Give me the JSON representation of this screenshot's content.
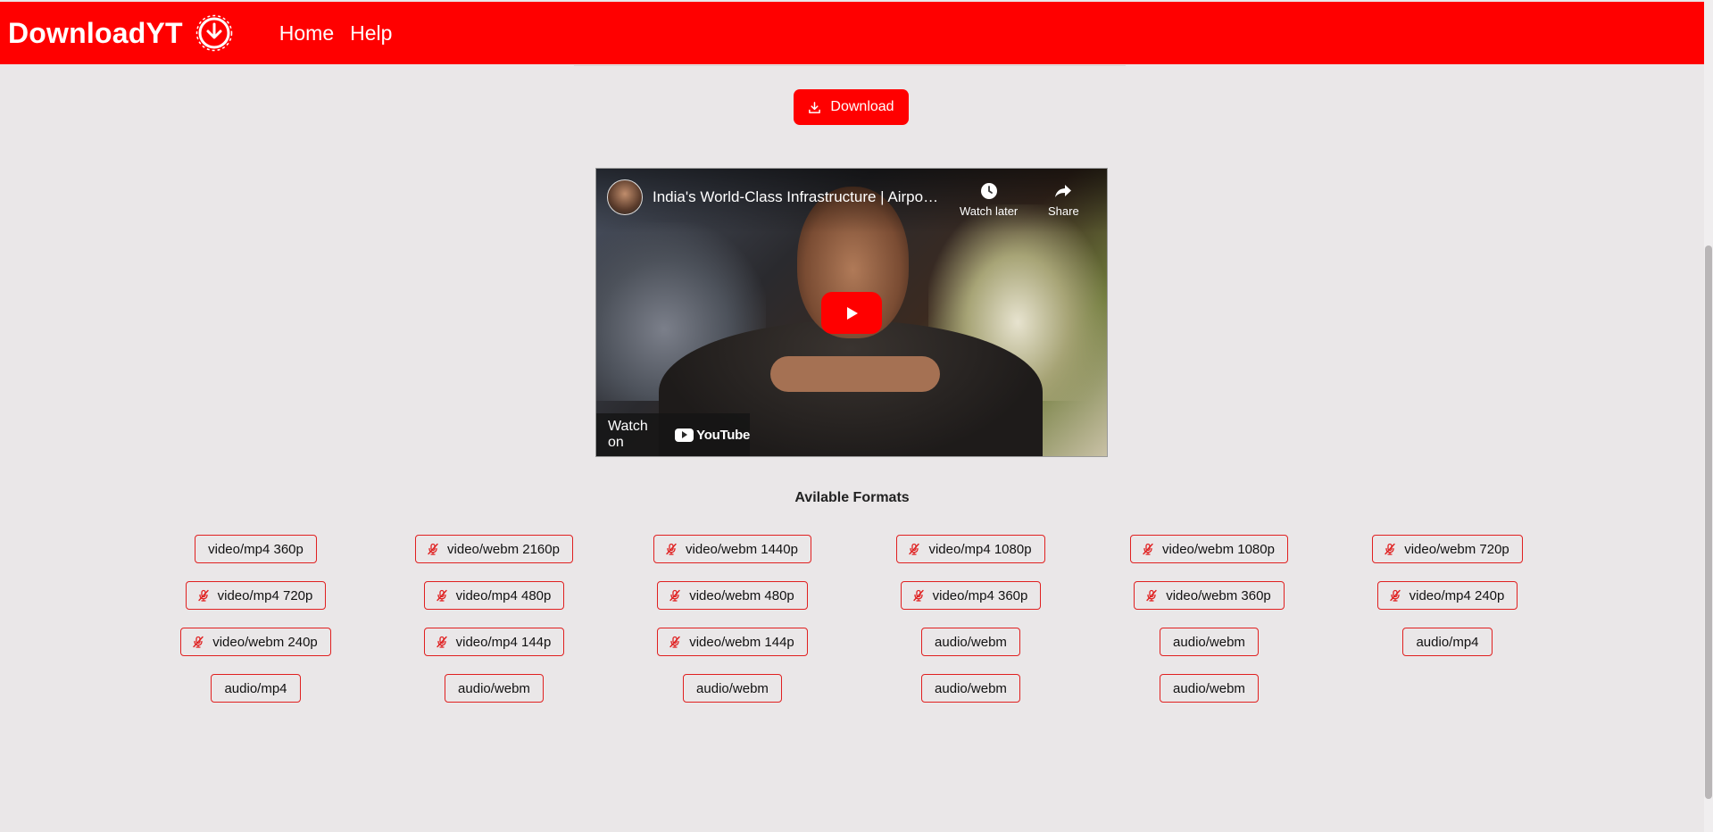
{
  "nav": {
    "brand": "DownloadYT",
    "links": [
      {
        "label": "Home"
      },
      {
        "label": "Help"
      }
    ],
    "color": "#ff0000"
  },
  "download_button": {
    "label": "Download"
  },
  "video": {
    "title": "India's World-Class Infrastructure | Airpo…",
    "watch_later": "Watch later",
    "share": "Share",
    "watch_on": "Watch on",
    "youtube": "YouTube"
  },
  "formats": {
    "heading": "Avilable Formats",
    "items": [
      {
        "label": "video/mp4 360p",
        "no_audio": false
      },
      {
        "label": "video/webm 2160p",
        "no_audio": true
      },
      {
        "label": "video/webm 1440p",
        "no_audio": true
      },
      {
        "label": "video/mp4 1080p",
        "no_audio": true
      },
      {
        "label": "video/webm 1080p",
        "no_audio": true
      },
      {
        "label": "video/webm 720p",
        "no_audio": true
      },
      {
        "label": "video/mp4 720p",
        "no_audio": true
      },
      {
        "label": "video/mp4 480p",
        "no_audio": true
      },
      {
        "label": "video/webm 480p",
        "no_audio": true
      },
      {
        "label": "video/mp4 360p",
        "no_audio": true
      },
      {
        "label": "video/webm 360p",
        "no_audio": true
      },
      {
        "label": "video/mp4 240p",
        "no_audio": true
      },
      {
        "label": "video/webm 240p",
        "no_audio": true
      },
      {
        "label": "video/mp4 144p",
        "no_audio": true
      },
      {
        "label": "video/webm 144p",
        "no_audio": true
      },
      {
        "label": "audio/webm",
        "no_audio": false
      },
      {
        "label": "audio/webm",
        "no_audio": false
      },
      {
        "label": "audio/mp4",
        "no_audio": false
      },
      {
        "label": "audio/mp4",
        "no_audio": false
      },
      {
        "label": "audio/webm",
        "no_audio": false
      },
      {
        "label": "audio/webm",
        "no_audio": false
      },
      {
        "label": "audio/webm",
        "no_audio": false
      },
      {
        "label": "audio/webm",
        "no_audio": false
      }
    ]
  },
  "icons": {
    "brand": "download-circle-icon",
    "download": "download-tray-icon",
    "no_audio": "mic-off-icon",
    "watch_later": "clock-icon",
    "share": "share-arrow-icon",
    "play": "play-icon"
  }
}
